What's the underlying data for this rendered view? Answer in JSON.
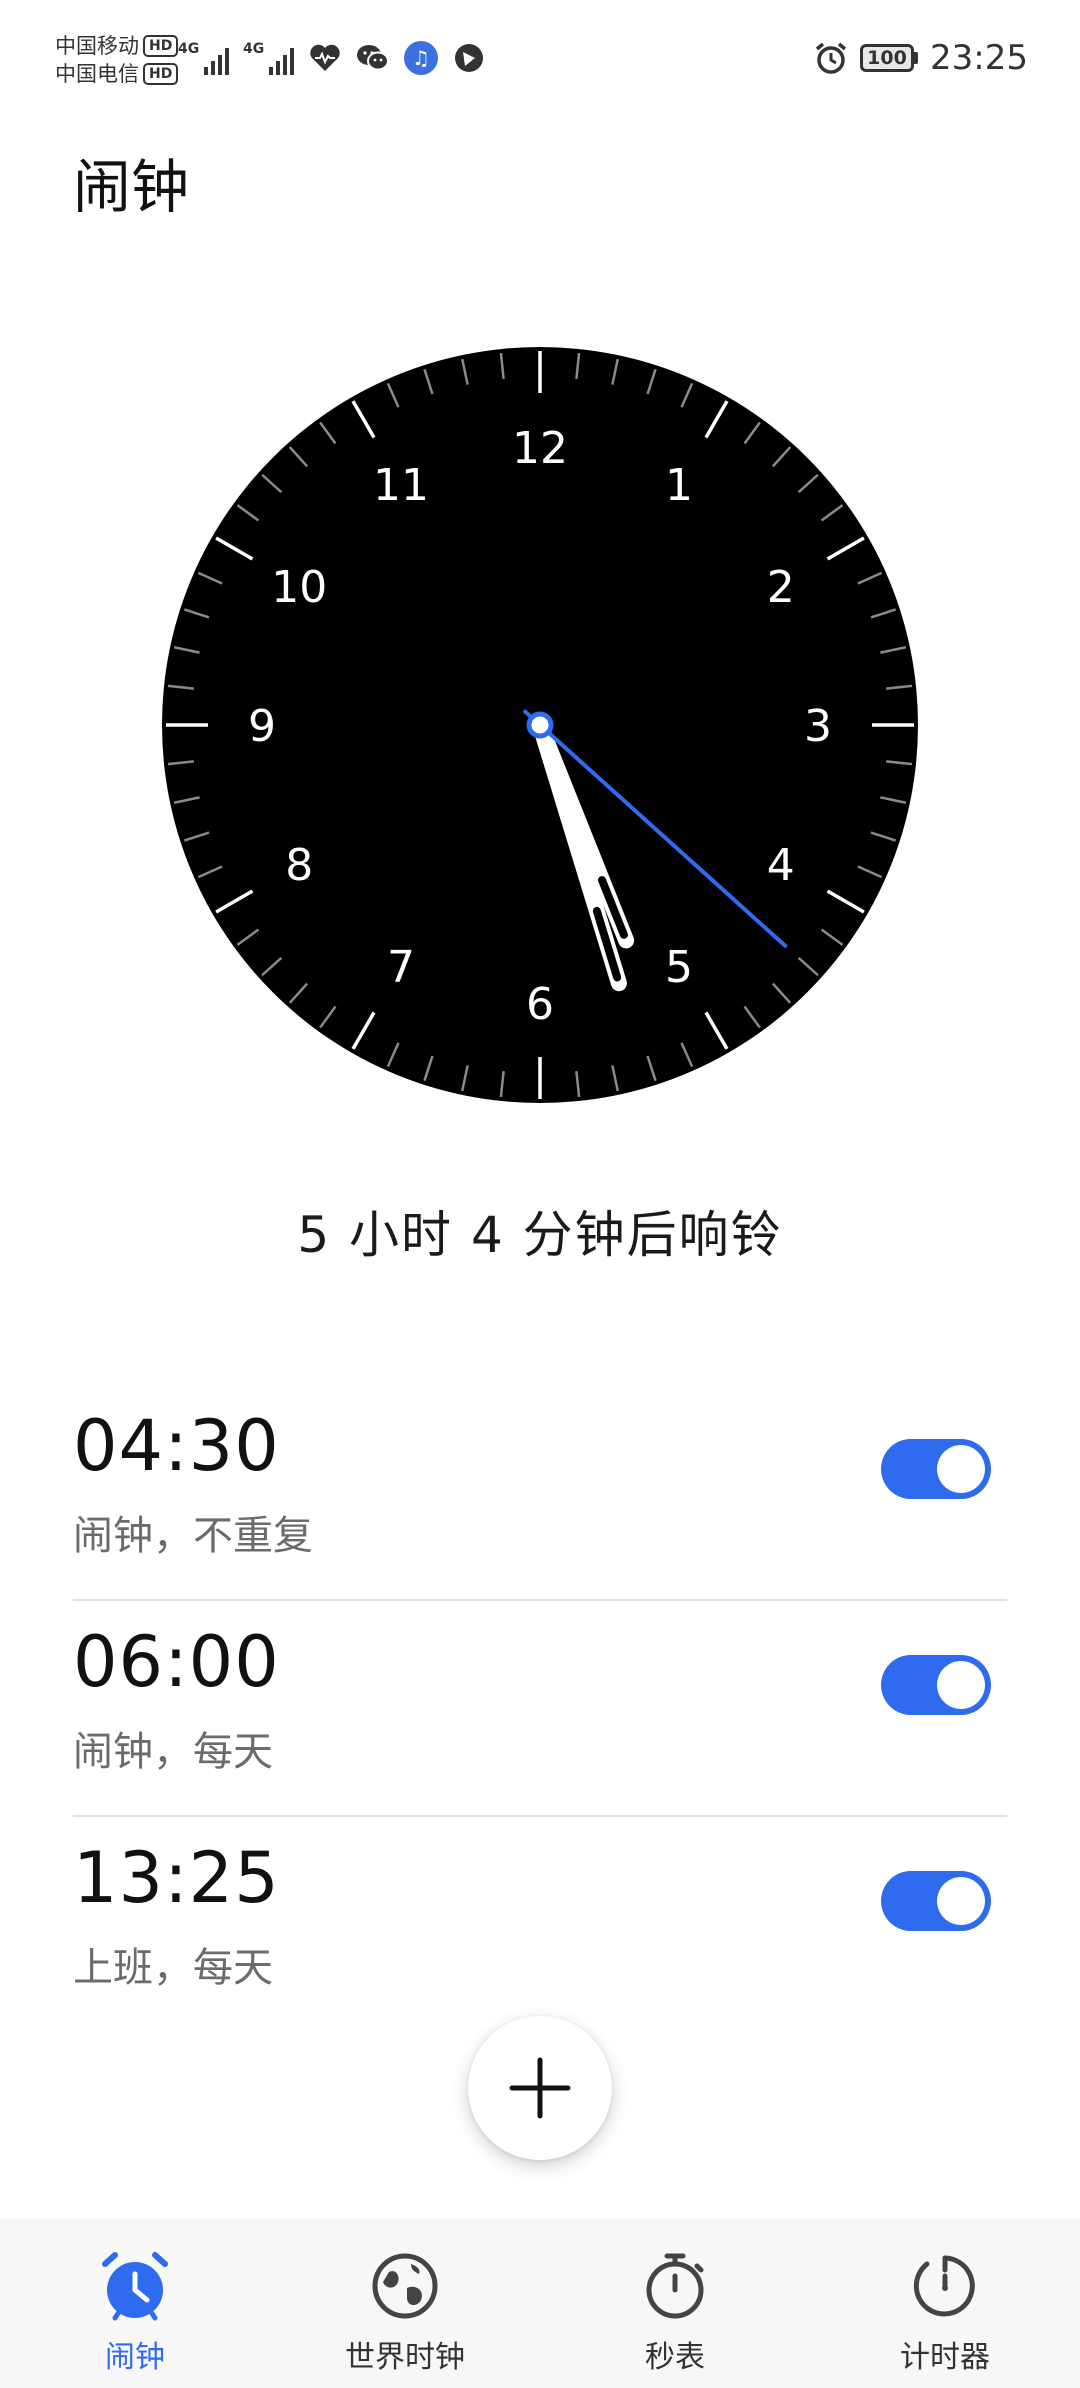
{
  "status_bar": {
    "carrier1": "中国移动",
    "carrier2": "中国电信",
    "hd": "HD",
    "network1": "4G",
    "network2": "4G",
    "battery": "100",
    "time": "23:25",
    "icons": [
      "signal-icon",
      "signal-icon",
      "health-icon",
      "wechat-icon",
      "music-icon",
      "app-icon",
      "alarm-status-icon"
    ]
  },
  "page_title": "闹钟",
  "analog_clock": {
    "numbers": [
      "12",
      "1",
      "2",
      "3",
      "4",
      "5",
      "6",
      "7",
      "8",
      "9",
      "10",
      "11"
    ],
    "time_shown": {
      "hour": 5,
      "minute": 26,
      "second": 22
    }
  },
  "countdown_text": "5 小时 4 分钟后响铃",
  "alarms": [
    {
      "time": "04:30",
      "desc": "闹钟，不重复",
      "enabled": true
    },
    {
      "time": "06:00",
      "desc": "闹钟，每天",
      "enabled": true
    },
    {
      "time": "13:25",
      "desc": "上班，每天",
      "enabled": true
    }
  ],
  "fab_icon": "plus-icon",
  "bottom_nav": [
    {
      "label": "闹钟",
      "icon": "alarm-clock-icon",
      "active": true
    },
    {
      "label": "世界时钟",
      "icon": "globe-icon",
      "active": false
    },
    {
      "label": "秒表",
      "icon": "stopwatch-icon",
      "active": false
    },
    {
      "label": "计时器",
      "icon": "timer-icon",
      "active": false
    }
  ],
  "colors": {
    "accent": "#2f6bef",
    "clock_face": "#000000",
    "text_secondary": "#6b6b6b"
  }
}
